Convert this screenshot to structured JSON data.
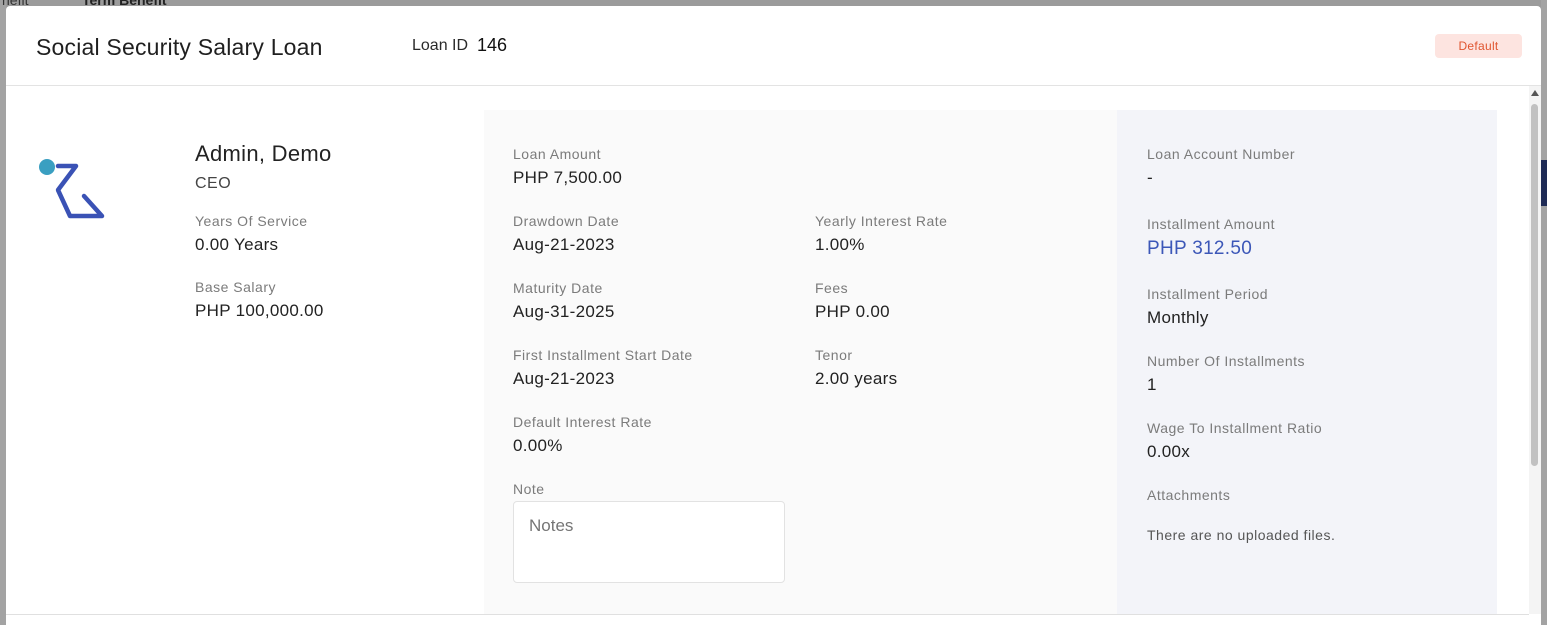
{
  "background": {
    "tab_left": "nefit",
    "tab_right": "Term Benefit"
  },
  "header": {
    "title": "Social Security Salary Loan",
    "loan_id_label": "Loan ID",
    "loan_id_value": "146",
    "status": "Default"
  },
  "employee": {
    "name": "Admin, Demo",
    "position": "CEO",
    "years_of_service_label": "Years Of Service",
    "years_of_service": "0.00 Years",
    "base_salary_label": "Base Salary",
    "base_salary": "PHP 100,000.00"
  },
  "loan": {
    "loan_amount_label": "Loan Amount",
    "loan_amount": "PHP 7,500.00",
    "drawdown_date_label": "Drawdown Date",
    "drawdown_date": "Aug-21-2023",
    "yearly_interest_rate_label": "Yearly Interest Rate",
    "yearly_interest_rate": "1.00%",
    "maturity_date_label": "Maturity Date",
    "maturity_date": "Aug-31-2025",
    "fees_label": "Fees",
    "fees": "PHP 0.00",
    "first_installment_label": "First Installment Start Date",
    "first_installment": "Aug-21-2023",
    "tenor_label": "Tenor",
    "tenor": "2.00 years",
    "default_interest_rate_label": "Default Interest Rate",
    "default_interest_rate": "0.00%",
    "note_label": "Note",
    "note_placeholder": "Notes"
  },
  "account": {
    "loan_account_number_label": "Loan Account Number",
    "loan_account_number": "-",
    "installment_amount_label": "Installment Amount",
    "installment_amount": "PHP 312.50",
    "installment_period_label": "Installment Period",
    "installment_period": "Monthly",
    "number_of_installments_label": "Number Of Installments",
    "number_of_installments": "1",
    "wage_ratio_label": "Wage To Installment Ratio",
    "wage_ratio": "0.00x",
    "attachments_label": "Attachments",
    "attachments_empty": "There are no uploaded files."
  },
  "colors": {
    "accent": "#3c57b8",
    "status_bg": "#fde4e0",
    "status_fg": "#e0552f",
    "logo_dot": "#3a9fc1",
    "logo_stroke": "#3a52b5"
  },
  "icons": {
    "logo": "company-logo-icon"
  }
}
